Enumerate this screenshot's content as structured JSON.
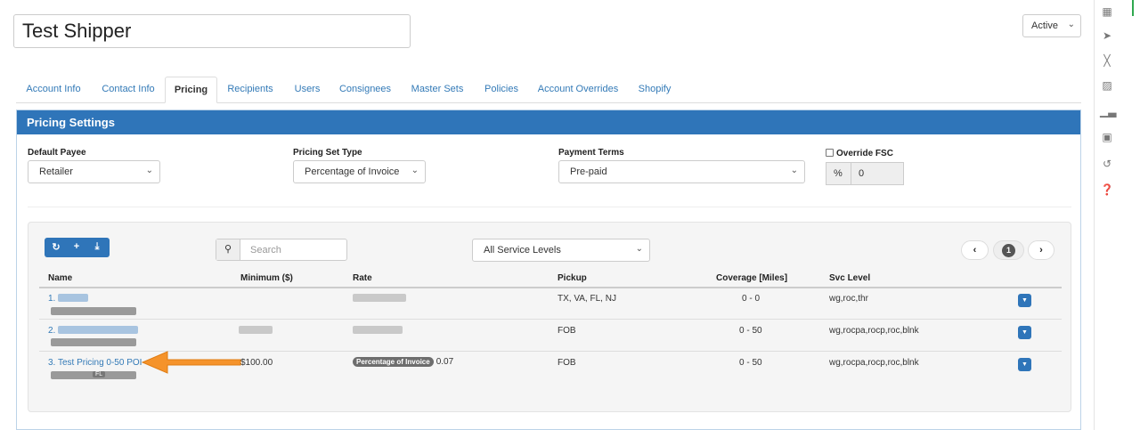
{
  "header": {
    "title": "Test Shipper",
    "status": "Active"
  },
  "tabs": [
    "Account Info",
    "Contact Info",
    "Pricing",
    "Recipients",
    "Users",
    "Consignees",
    "Master Sets",
    "Policies",
    "Account Overrides",
    "Shopify"
  ],
  "active_tab": "Pricing",
  "panel": {
    "title": "Pricing Settings",
    "default_payee": {
      "label": "Default Payee",
      "value": "Retailer"
    },
    "pricing_set_type": {
      "label": "Pricing Set Type",
      "value": "Percentage of Invoice"
    },
    "payment_terms": {
      "label": "Payment Terms",
      "value": "Pre-paid"
    },
    "override_fsc": {
      "label": "Override FSC",
      "checked": false,
      "addon": "%",
      "value": "0"
    }
  },
  "toolbar": {
    "refresh_icon": "refresh-icon",
    "add_icon": "plus-icon",
    "download_icon": "download-icon",
    "search_placeholder": "Search",
    "service_level": "All Service Levels",
    "page": "1"
  },
  "table": {
    "columns": [
      "Name",
      "Minimum ($)",
      "Rate",
      "Pickup",
      "Coverage [Miles]",
      "Svc Level"
    ],
    "rows": [
      {
        "index": "1.",
        "name": "",
        "minimum": "",
        "rate_badge": "",
        "rate": "",
        "pickup": "TX, VA, FL, NJ",
        "coverage": "0 - 0",
        "svc_level": "wg,roc,thr"
      },
      {
        "index": "2.",
        "name": "",
        "minimum": "",
        "rate_badge": "",
        "rate": "",
        "pickup": "FOB",
        "coverage": "0 - 50",
        "svc_level": "wg,rocpa,rocp,roc,blnk"
      },
      {
        "index": "3.",
        "name": "Test Pricing 0-50 POI",
        "minimum": "$100.00",
        "rate_badge": "Percentage of Invoice",
        "rate": "0.07",
        "pickup": "FOB",
        "coverage": "0 - 50",
        "svc_level": "wg,rocpa,rocp,roc,blnk",
        "tag": "FL"
      }
    ]
  },
  "colors": {
    "primary": "#2f75b9",
    "annotation_arrow": "#f5932b",
    "link": "#337ab7"
  }
}
